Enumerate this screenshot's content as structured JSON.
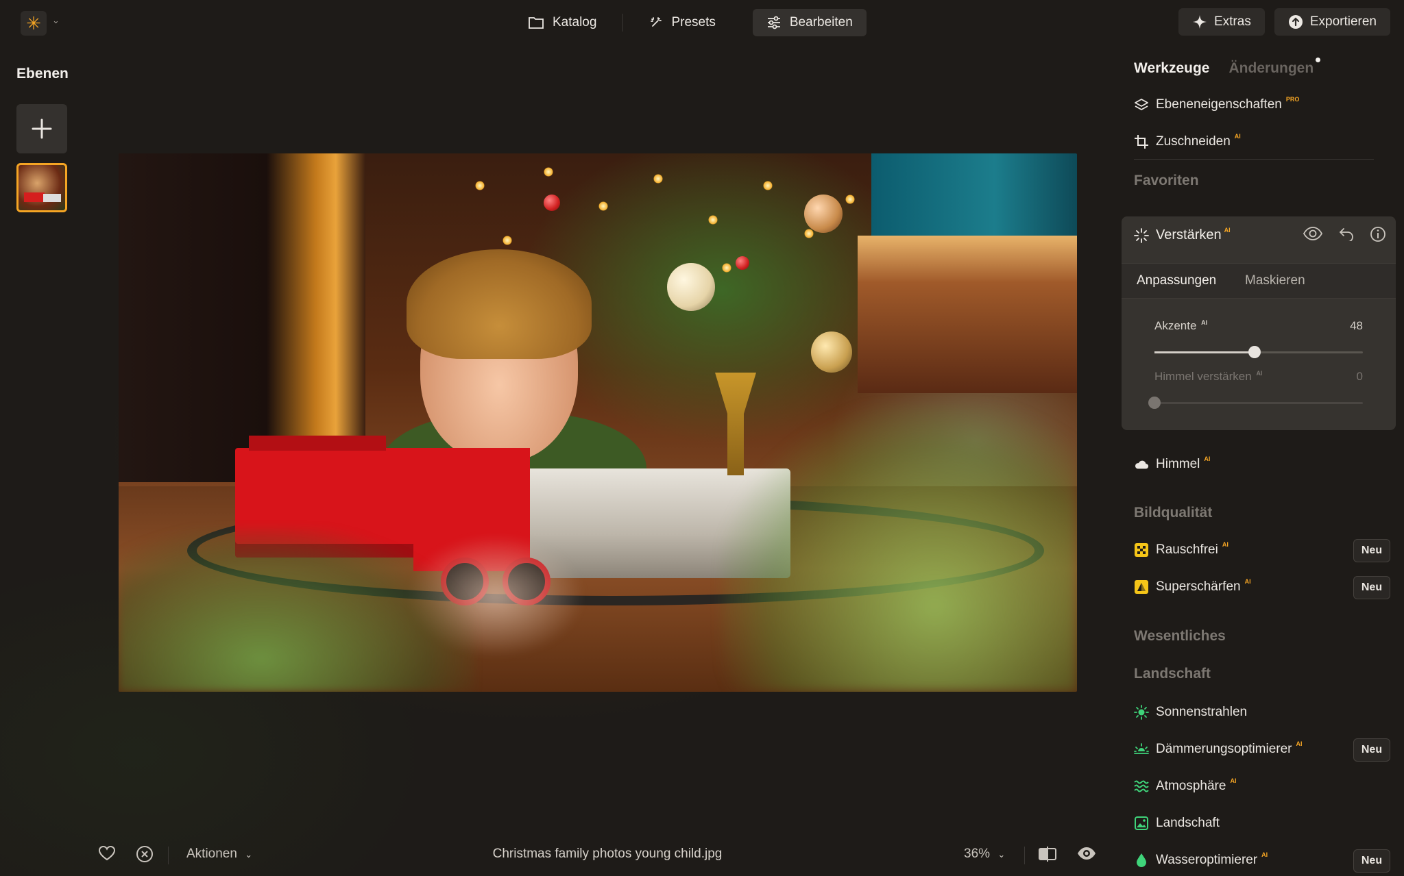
{
  "topbar": {
    "nav": [
      {
        "label": "Katalog",
        "icon": "folder-icon"
      },
      {
        "label": "Presets",
        "icon": "sparkle-wand-icon"
      },
      {
        "label": "Bearbeiten",
        "icon": "sliders-icon",
        "active": true
      }
    ],
    "extras_label": "Extras",
    "export_label": "Exportieren"
  },
  "layers": {
    "title": "Ebenen"
  },
  "bottom": {
    "actions_label": "Aktionen",
    "filename": "Christmas family photos young child.jpg",
    "zoom": "36%"
  },
  "panel": {
    "tabs": [
      "Werkzeuge",
      "Änderungen"
    ],
    "tools_top": [
      {
        "label": "Ebeneneigenschaften",
        "badge": "PRO"
      },
      {
        "label": "Zuschneiden",
        "badge": "AI"
      }
    ],
    "favorites": "Favoriten",
    "enhance": {
      "title": "Verstärken",
      "badge": "AI",
      "subtabs": [
        "Anpassungen",
        "Maskieren"
      ],
      "sliders": [
        {
          "label": "Akzente",
          "badge": "AI",
          "value": 48,
          "fraction": 0.48,
          "enabled": true
        },
        {
          "label": "Himmel verstärken",
          "badge": "AI",
          "value": 0,
          "fraction": 0,
          "enabled": false
        }
      ]
    },
    "sky": {
      "label": "Himmel",
      "badge": "AI"
    },
    "quality": {
      "title": "Bildqualität",
      "items": [
        {
          "label": "Rauschfrei",
          "badge": "AI",
          "tag": "Neu"
        },
        {
          "label": "Superschärfen",
          "badge": "AI",
          "tag": "Neu"
        }
      ]
    },
    "essentials": "Wesentliches",
    "landscape": {
      "title": "Landschaft",
      "items": [
        {
          "label": "Sonnenstrahlen",
          "badge": "",
          "tag": ""
        },
        {
          "label": "Dämmerungsoptimierer",
          "badge": "AI",
          "tag": "Neu"
        },
        {
          "label": "Atmosphäre",
          "badge": "AI",
          "tag": ""
        },
        {
          "label": "Landschaft",
          "badge": "",
          "tag": ""
        },
        {
          "label": "Wasseroptimierer",
          "badge": "AI",
          "tag": "Neu"
        }
      ]
    }
  },
  "colors": {
    "accent": "#f5a524",
    "green_icon": "#3fd47a",
    "yellow_icon": "#f5c518"
  }
}
